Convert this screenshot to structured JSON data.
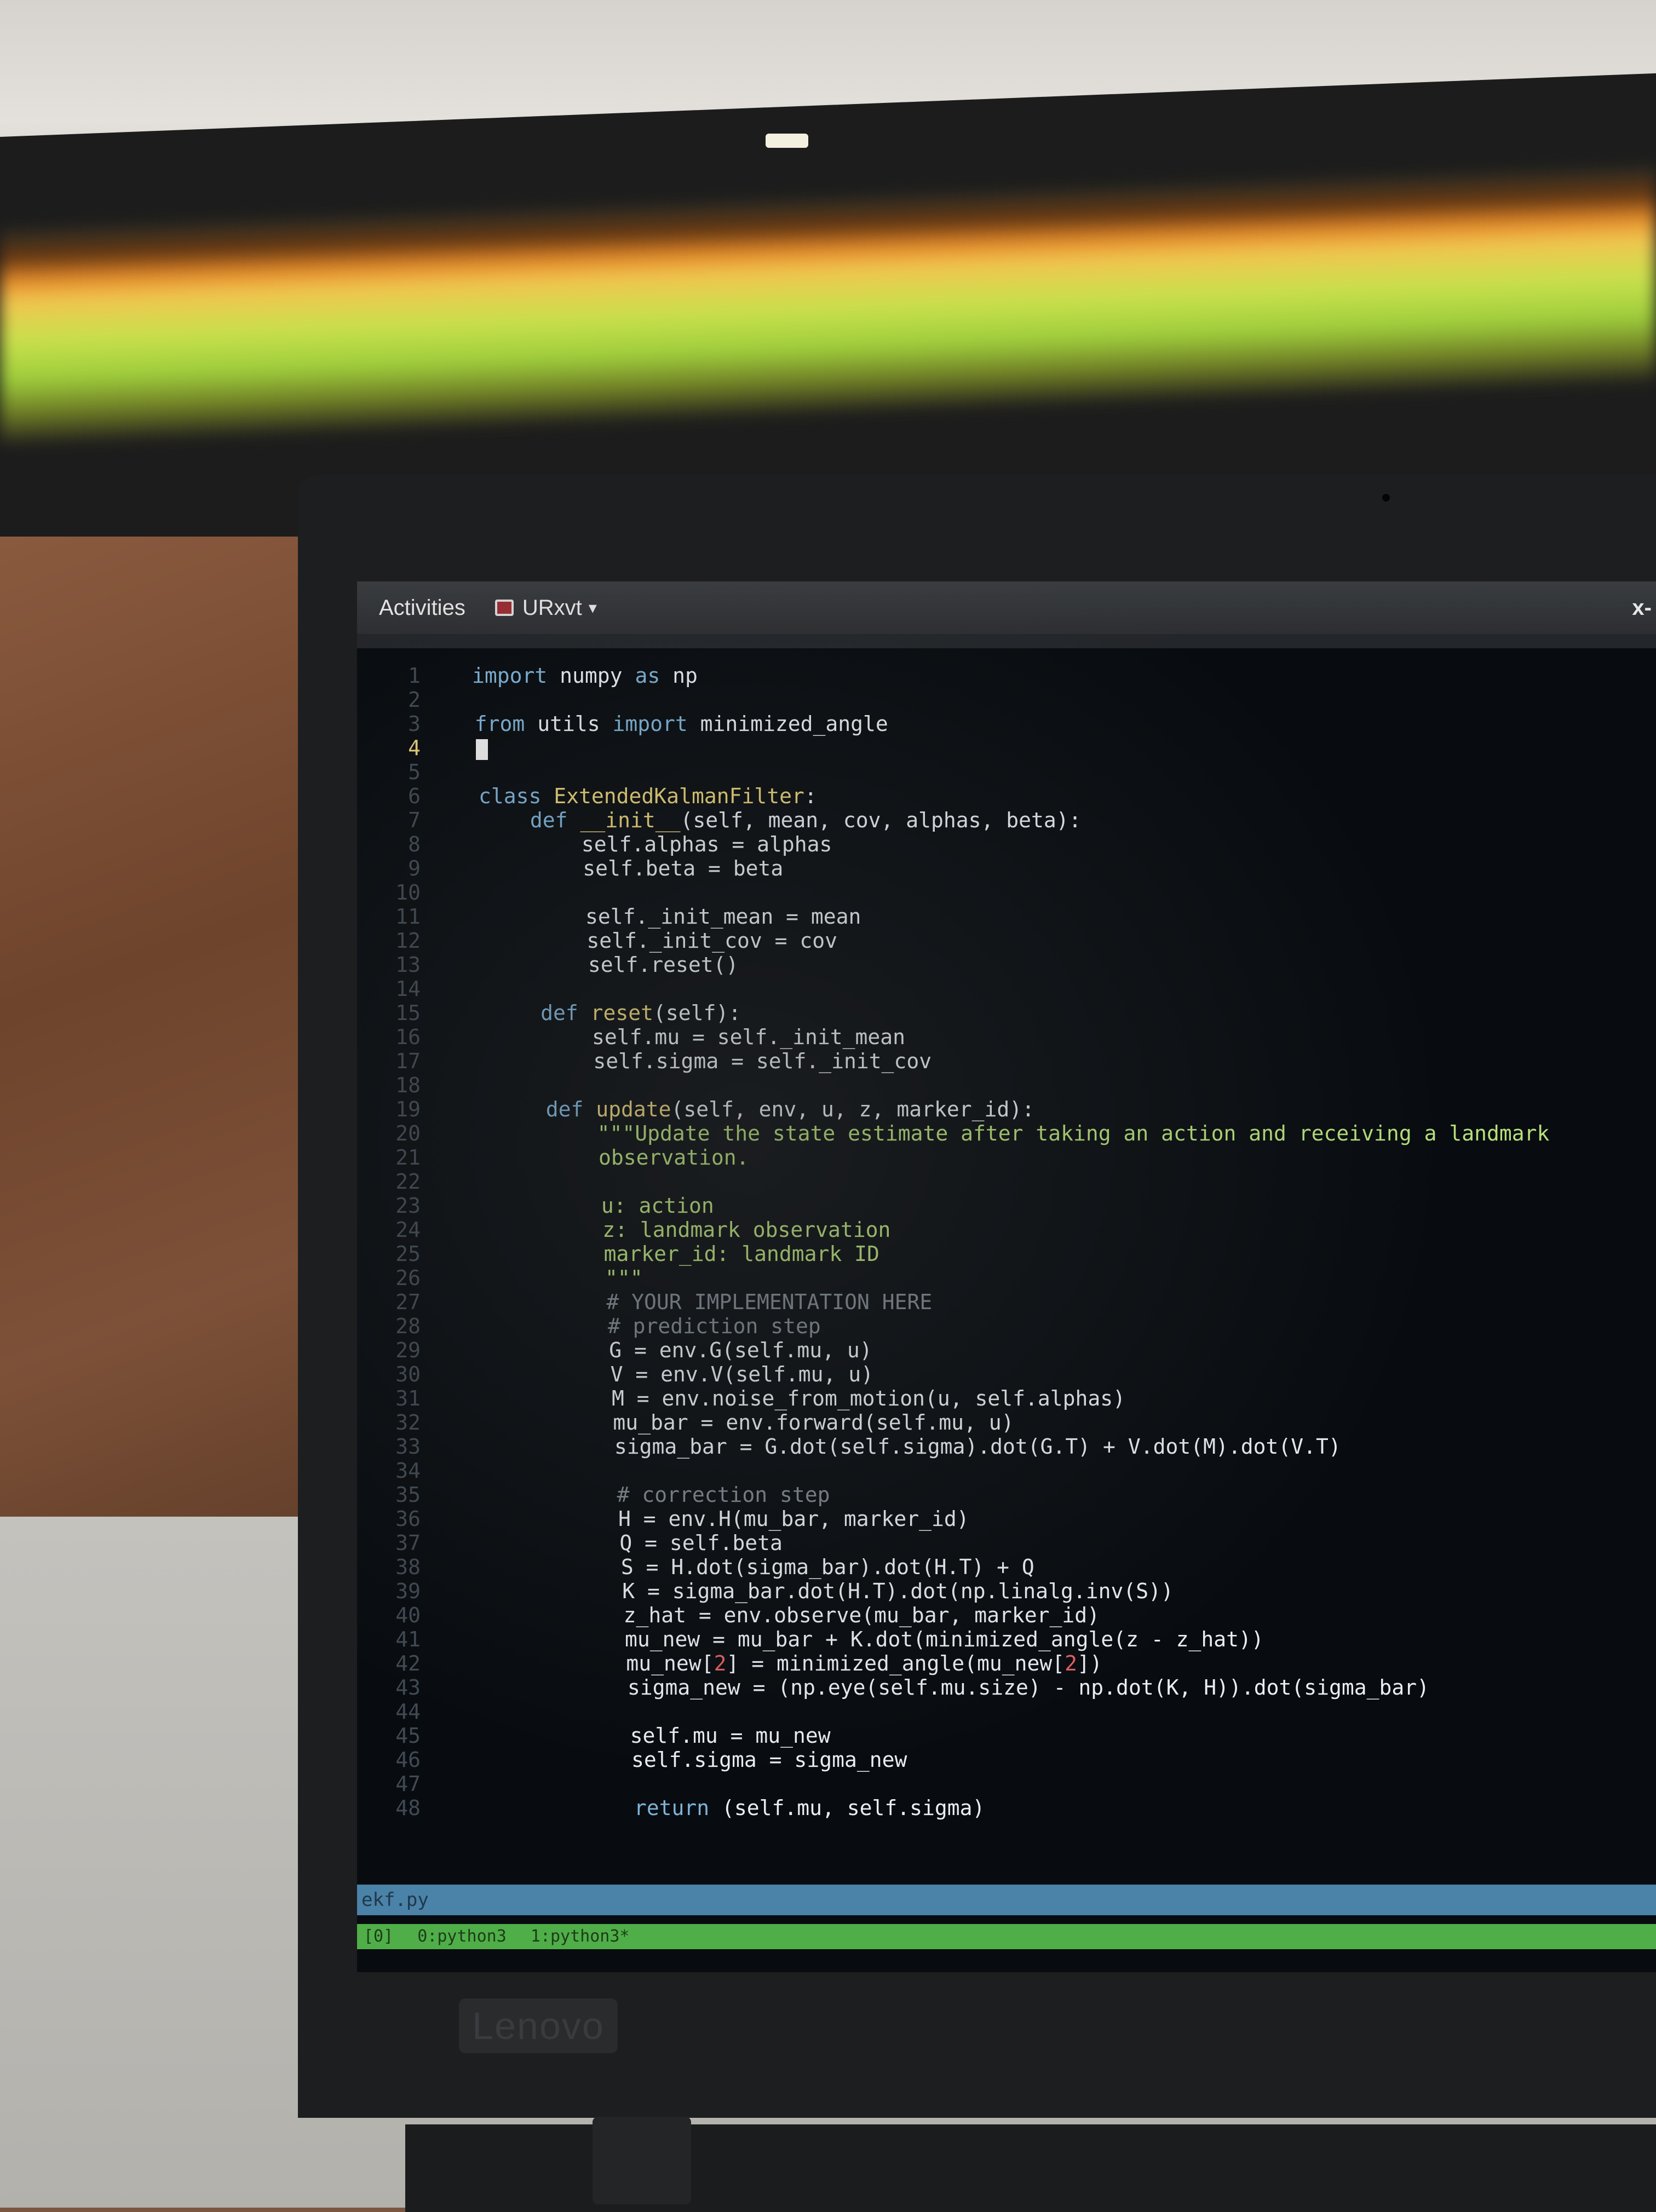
{
  "topbar": {
    "activities": "Activities",
    "app_name": "URxvt",
    "right_label": "x-"
  },
  "editor": {
    "lines": [
      {
        "n": "1",
        "tokens": [
          {
            "t": "import",
            "c": "kw"
          },
          {
            "t": " numpy "
          },
          {
            "t": "as",
            "c": "kw"
          },
          {
            "t": " np"
          }
        ]
      },
      {
        "n": "2",
        "tokens": []
      },
      {
        "n": "3",
        "tokens": [
          {
            "t": "from",
            "c": "kw"
          },
          {
            "t": " utils "
          },
          {
            "t": "import",
            "c": "kw"
          },
          {
            "t": " minimized_angle"
          }
        ]
      },
      {
        "n": "4",
        "tokens": [],
        "cursor": true
      },
      {
        "n": "5",
        "tokens": []
      },
      {
        "n": "6",
        "tokens": [
          {
            "t": "class",
            "c": "kw"
          },
          {
            "t": " "
          },
          {
            "t": "ExtendedKalmanFilter",
            "c": "cls"
          },
          {
            "t": ":"
          }
        ]
      },
      {
        "n": "7",
        "tokens": [
          {
            "t": "    "
          },
          {
            "t": "def",
            "c": "kw"
          },
          {
            "t": " "
          },
          {
            "t": "__init__",
            "c": "fn"
          },
          {
            "t": "(self, mean, cov, alphas, beta):"
          }
        ]
      },
      {
        "n": "8",
        "tokens": [
          {
            "t": "        self.alphas = alphas"
          }
        ]
      },
      {
        "n": "9",
        "tokens": [
          {
            "t": "        self.beta = beta"
          }
        ]
      },
      {
        "n": "10",
        "tokens": []
      },
      {
        "n": "11",
        "tokens": [
          {
            "t": "        self._init_mean = mean"
          }
        ]
      },
      {
        "n": "12",
        "tokens": [
          {
            "t": "        self._init_cov = cov"
          }
        ]
      },
      {
        "n": "13",
        "tokens": [
          {
            "t": "        self.reset()"
          }
        ]
      },
      {
        "n": "14",
        "tokens": []
      },
      {
        "n": "15",
        "tokens": [
          {
            "t": "    "
          },
          {
            "t": "def",
            "c": "kw"
          },
          {
            "t": " "
          },
          {
            "t": "reset",
            "c": "fn"
          },
          {
            "t": "(self):"
          }
        ]
      },
      {
        "n": "16",
        "tokens": [
          {
            "t": "        self.mu = self._init_mean"
          }
        ]
      },
      {
        "n": "17",
        "tokens": [
          {
            "t": "        self.sigma = self._init_cov"
          }
        ]
      },
      {
        "n": "18",
        "tokens": []
      },
      {
        "n": "19",
        "tokens": [
          {
            "t": "    "
          },
          {
            "t": "def",
            "c": "kw"
          },
          {
            "t": " "
          },
          {
            "t": "update",
            "c": "fn"
          },
          {
            "t": "(self, env, u, z, marker_id):"
          }
        ]
      },
      {
        "n": "20",
        "tokens": [
          {
            "t": "        "
          },
          {
            "t": "\"\"\"Update the state estimate after taking an action and receiving a landmark",
            "c": "str"
          }
        ]
      },
      {
        "n": "21",
        "tokens": [
          {
            "t": "        "
          },
          {
            "t": "observation.",
            "c": "str"
          }
        ]
      },
      {
        "n": "22",
        "tokens": []
      },
      {
        "n": "23",
        "tokens": [
          {
            "t": "        "
          },
          {
            "t": "u: action",
            "c": "str"
          }
        ]
      },
      {
        "n": "24",
        "tokens": [
          {
            "t": "        "
          },
          {
            "t": "z: landmark observation",
            "c": "str"
          }
        ]
      },
      {
        "n": "25",
        "tokens": [
          {
            "t": "        "
          },
          {
            "t": "marker_id: landmark ID",
            "c": "str"
          }
        ]
      },
      {
        "n": "26",
        "tokens": [
          {
            "t": "        "
          },
          {
            "t": "\"\"\"",
            "c": "str"
          }
        ]
      },
      {
        "n": "27",
        "tokens": [
          {
            "t": "        "
          },
          {
            "t": "# YOUR IMPLEMENTATION HERE",
            "c": "cmt"
          }
        ]
      },
      {
        "n": "28",
        "tokens": [
          {
            "t": "        "
          },
          {
            "t": "# prediction step",
            "c": "cmt"
          }
        ]
      },
      {
        "n": "29",
        "tokens": [
          {
            "t": "        G = env.G(self.mu, u)"
          }
        ]
      },
      {
        "n": "30",
        "tokens": [
          {
            "t": "        V = env.V(self.mu, u)"
          }
        ]
      },
      {
        "n": "31",
        "tokens": [
          {
            "t": "        M = env.noise_from_motion(u, self.alphas)"
          }
        ]
      },
      {
        "n": "32",
        "tokens": [
          {
            "t": "        mu_bar = env.forward(self.mu, u)"
          }
        ]
      },
      {
        "n": "33",
        "tokens": [
          {
            "t": "        sigma_bar = G.dot(self.sigma).dot(G.T) + V.dot(M).dot(V.T)"
          }
        ]
      },
      {
        "n": "34",
        "tokens": []
      },
      {
        "n": "35",
        "tokens": [
          {
            "t": "        "
          },
          {
            "t": "# correction step",
            "c": "cmt"
          }
        ]
      },
      {
        "n": "36",
        "tokens": [
          {
            "t": "        H = env.H(mu_bar, marker_id)"
          }
        ]
      },
      {
        "n": "37",
        "tokens": [
          {
            "t": "        Q = self.beta"
          }
        ]
      },
      {
        "n": "38",
        "tokens": [
          {
            "t": "        S = H.dot(sigma_bar).dot(H.T) + Q"
          }
        ]
      },
      {
        "n": "39",
        "tokens": [
          {
            "t": "        K = sigma_bar.dot(H.T).dot(np.linalg.inv(S))"
          }
        ]
      },
      {
        "n": "40",
        "tokens": [
          {
            "t": "        z_hat = env.observe(mu_bar, marker_id)"
          }
        ]
      },
      {
        "n": "41",
        "tokens": [
          {
            "t": "        mu_new = mu_bar + K.dot(minimized_angle(z - z_hat))"
          }
        ]
      },
      {
        "n": "42",
        "tokens": [
          {
            "t": "        mu_new["
          },
          {
            "t": "2",
            "c": "num"
          },
          {
            "t": "] = minimized_angle(mu_new["
          },
          {
            "t": "2",
            "c": "num"
          },
          {
            "t": "])"
          }
        ]
      },
      {
        "n": "43",
        "tokens": [
          {
            "t": "        sigma_new = (np.eye(self.mu.size) - np.dot(K, H)).dot(sigma_bar)"
          }
        ]
      },
      {
        "n": "44",
        "tokens": []
      },
      {
        "n": "45",
        "tokens": [
          {
            "t": "        self.mu = mu_new"
          }
        ]
      },
      {
        "n": "46",
        "tokens": [
          {
            "t": "        self.sigma = sigma_new"
          }
        ]
      },
      {
        "n": "47",
        "tokens": []
      },
      {
        "n": "48",
        "tokens": [
          {
            "t": "        "
          },
          {
            "t": "return",
            "c": "kw"
          },
          {
            "t": " (self.mu, self.sigma)"
          }
        ]
      }
    ]
  },
  "statusbar": {
    "filename": "ekf.py"
  },
  "tmux": {
    "session": "[0]",
    "windows": [
      "0:python3",
      "1:python3*"
    ]
  },
  "laptop": {
    "brand": "Lenovo"
  },
  "colors": {
    "keyword": "#7eb3d8",
    "class_name": "#e8d27a",
    "string": "#b8e07a",
    "comment": "#7d8890",
    "statusbar": "#4a82a8",
    "tmuxbar": "#4fae48"
  }
}
